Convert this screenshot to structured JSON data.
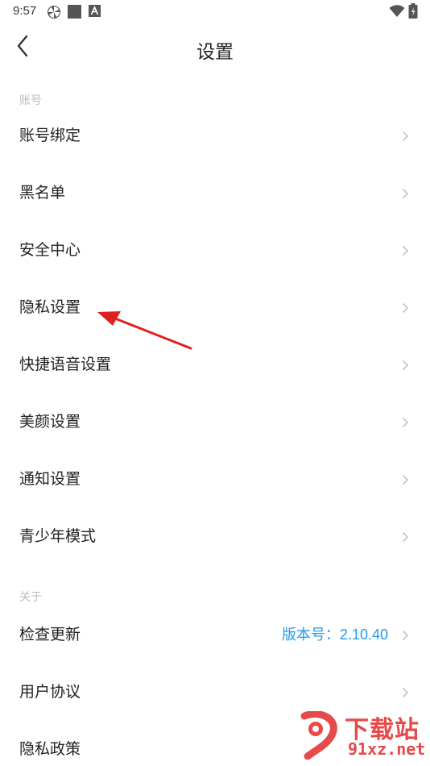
{
  "status_bar": {
    "time": "9:57",
    "left_icons": [
      "pinwheel-icon",
      "square-icon",
      "a-badge-icon"
    ],
    "right_icons": [
      "wifi-icon",
      "battery-icon"
    ]
  },
  "header": {
    "back_icon": "chevron-left-icon",
    "title": "设置"
  },
  "sections": [
    {
      "label": "账号",
      "items": [
        {
          "label": "账号绑定"
        },
        {
          "label": "黑名单"
        },
        {
          "label": "安全中心"
        },
        {
          "label": "隐私设置"
        },
        {
          "label": "快捷语音设置"
        },
        {
          "label": "美颜设置"
        },
        {
          "label": "通知设置"
        },
        {
          "label": "青少年模式"
        }
      ]
    },
    {
      "label": "关于",
      "items": [
        {
          "label": "检查更新",
          "value": "版本号：2.10.40"
        },
        {
          "label": "用户协议"
        },
        {
          "label": "隐私政策"
        }
      ]
    }
  ],
  "annotation": {
    "type": "red-arrow",
    "points_to": "隐私设置",
    "color": "#e02020"
  },
  "watermark": {
    "text": "下载站",
    "url": "91xz.net",
    "color": "#e64a4a"
  },
  "colors": {
    "accent": "#1e9cf0",
    "section_label": "#bdbdbd",
    "chevron": "#c4c4c4"
  }
}
